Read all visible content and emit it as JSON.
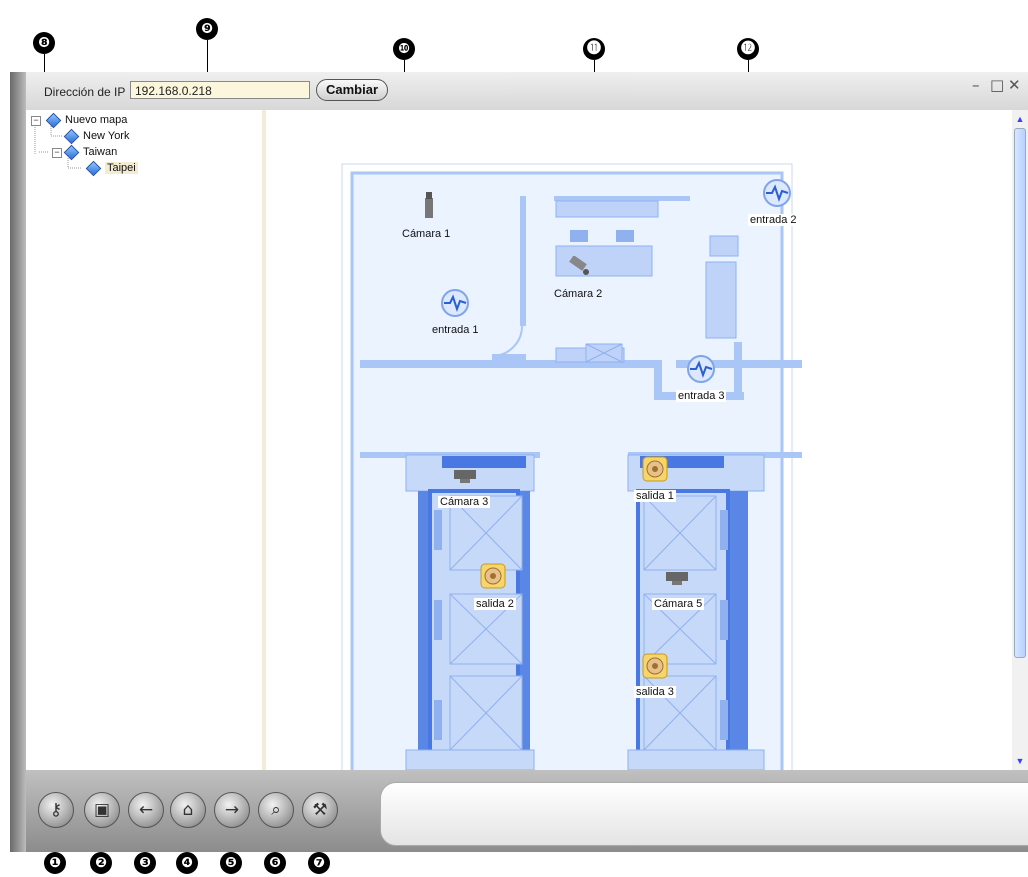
{
  "callouts": {
    "c1": "❶",
    "c2": "❷",
    "c3": "❸",
    "c4": "❹",
    "c5": "❺",
    "c6": "❻",
    "c7": "❼",
    "c8": "❽",
    "c9": "❾",
    "c10": "❿",
    "c11": "⓫",
    "c12": "⓬"
  },
  "toolbar_top": {
    "ip_label": "Dirección de IP",
    "ip_value": "192.168.0.218",
    "change_button": "Cambiar",
    "minimize_glyph": "–",
    "maximize_glyph": "□",
    "close_glyph": "✕"
  },
  "tree": {
    "root": "Nuevo mapa",
    "items": [
      "New York",
      "Taiwan",
      "Taipei"
    ],
    "expander_glyph": "−"
  },
  "map": {
    "cameras": [
      "Cámara 1",
      "Cámara 2",
      "Cámara 3",
      "Cámara 5"
    ],
    "inputs": [
      "entrada 1",
      "entrada 2",
      "entrada 3"
    ],
    "outputs": [
      "salida 1",
      "salida 2",
      "salida 3"
    ]
  },
  "scroll": {
    "up": "▲",
    "down": "▼"
  },
  "bottom_toolbar": {
    "icons": [
      "key-icon",
      "monitor-info-icon",
      "back-arrow-icon",
      "home-icon",
      "forward-arrow-icon",
      "search-icon",
      "tools-icon"
    ],
    "glyphs": [
      "⚷",
      "▣",
      "←",
      "⌂",
      "→",
      "⌕",
      "⚒"
    ]
  },
  "colors": {
    "floorplan": "#a9c6f7",
    "floor_bg": "#eaf3ff",
    "ip_field_bg": "#fbf6dc"
  }
}
